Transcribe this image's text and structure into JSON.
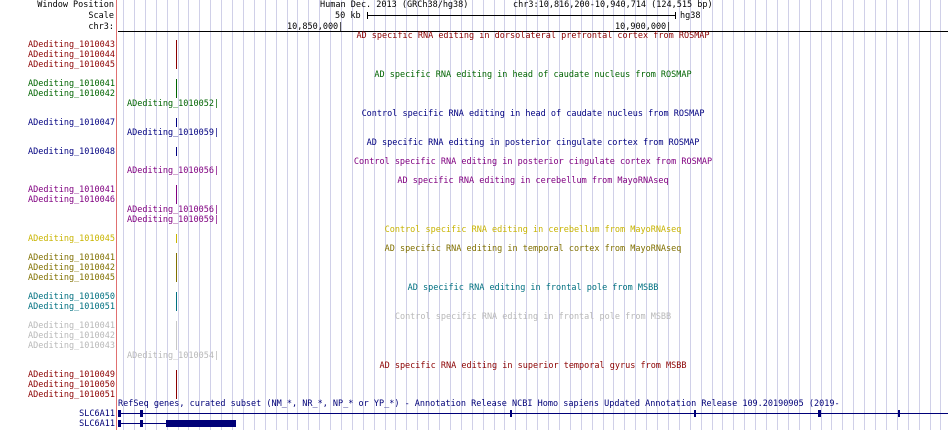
{
  "header": {
    "window_position_label": "Window Position",
    "scale_label": "Scale",
    "chr_label": "chr3:",
    "assembly": "Human Dec. 2013 (GRCh38/hg38)",
    "position": "chr3:10,816,200-10,940,714 (124,515 bp)",
    "scale_value": "50 kb",
    "scale_db": "hg38",
    "coord1": "10,850,000|",
    "coord2": "10,900,000|"
  },
  "colors": {
    "darkred": "#8b0000",
    "green": "#006400",
    "navy": "#000080",
    "purple": "#800080",
    "gold": "#c8b400",
    "olive": "#807000",
    "teal": "#007080",
    "lightgray": "#b8b8b8",
    "gene": "#000078"
  },
  "left_labels": {
    "l1": "ADediting_1010043",
    "l2": "ADediting_1010044",
    "l3": "ADediting_1010045",
    "l4": "ADediting_1010041",
    "l5": "ADediting_1010042",
    "l6": "ADediting_1010047",
    "l7": "ADediting_1010048",
    "l8": "ADediting_1010041",
    "l9": "ADediting_1010046",
    "l10": "ADediting_1010045",
    "l11": "ADediting_1010041",
    "l12": "ADediting_1010042",
    "l13": "ADediting_1010045",
    "l14": "ADediting_1010050",
    "l15": "ADediting_1010051",
    "l16": "ADediting_1010041",
    "l17": "ADediting_1010042",
    "l18": "ADediting_1010043",
    "l19": "ADediting_1010049",
    "l20": "ADediting_1010050",
    "l21": "ADediting_1010051",
    "gene1": "SLC6A11",
    "gene2": "SLC6A11"
  },
  "inline_labels": {
    "i1": "ADediting_1010052|",
    "i2": "ADediting_1010059|",
    "i3": "ADediting_1010056|",
    "i4": "ADediting_1010056|",
    "i5": "ADediting_1010059|",
    "i6": "ADediting_1010054|"
  },
  "track_titles": {
    "t1": "AD specific RNA editing in dorsolateral prefrontal cortex from ROSMAP",
    "t2": "AD specific RNA editing in head of caudate nucleus from ROSMAP",
    "t3": "Control specific RNA editing in head of caudate nucleus from ROSMAP",
    "t4": "AD specific RNA editing in posterior cingulate cortex from ROSMAP",
    "t5": "Control specific RNA editing in posterior cingulate cortex from ROSMAP",
    "t6": "AD specific RNA editing in cerebellum from MayoRNAseq",
    "t7": "Control specific RNA editing in cerebellum from MayoRNAseq",
    "t8": "AD specific RNA editing in temporal cortex from MayoRNAseq",
    "t9": "AD specific RNA editing in frontal pole from MSBB",
    "t10": "Control specific RNA editing in frontal pole from MSBB",
    "t11": "AD specific RNA editing in superior temporal gyrus from MSBB",
    "gene_track": "RefSeq genes, curated subset (NM_*, NR_*, NP_* or YP_*) - Annotation Release NCBI Homo sapiens Updated Annotation Release 109.20190905 (2019-"
  }
}
